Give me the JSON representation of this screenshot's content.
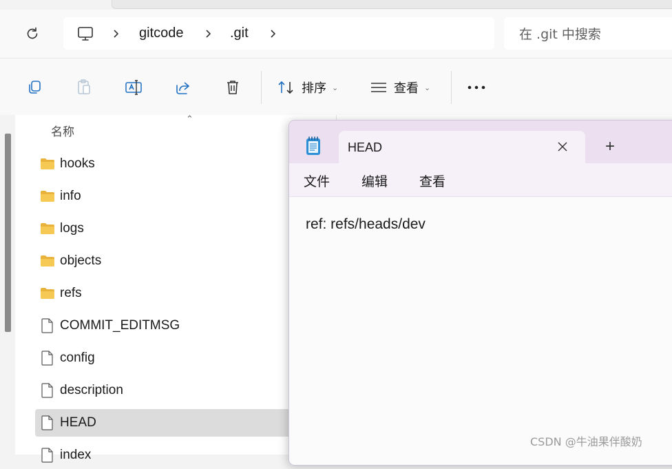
{
  "explorer": {
    "breadcrumb": [
      "gitcode",
      ".git"
    ],
    "search_placeholder": "在 .git 中搜索",
    "toolbar": {
      "sort_label": "排序",
      "view_label": "查看"
    },
    "column_header": "名称",
    "files": [
      {
        "name": "hooks",
        "type": "folder"
      },
      {
        "name": "info",
        "type": "folder"
      },
      {
        "name": "logs",
        "type": "folder"
      },
      {
        "name": "objects",
        "type": "folder"
      },
      {
        "name": "refs",
        "type": "folder"
      },
      {
        "name": "COMMIT_EDITMSG",
        "type": "file"
      },
      {
        "name": "config",
        "type": "file"
      },
      {
        "name": "description",
        "type": "file"
      },
      {
        "name": "HEAD",
        "type": "file",
        "selected": true
      },
      {
        "name": "index",
        "type": "file"
      }
    ]
  },
  "notepad": {
    "tab_title": "HEAD",
    "new_tab_glyph": "+",
    "menu": [
      "文件",
      "编辑",
      "查看"
    ],
    "content": "ref: refs/heads/dev"
  },
  "watermark": "CSDN @牛油果伴酸奶",
  "colors": {
    "folder": "#f2c14e",
    "notepad_titlebar": "#ebdff0",
    "notepad_icon": "#2d8fd5",
    "selection": "#dcdcdc"
  }
}
